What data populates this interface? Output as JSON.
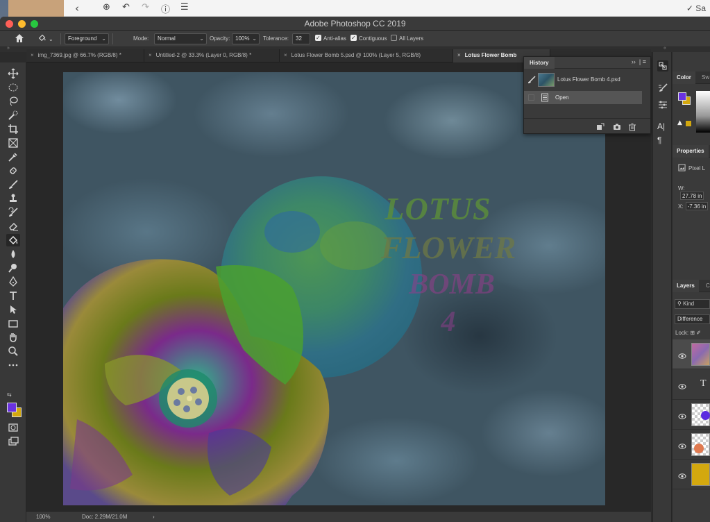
{
  "back_window": {
    "right_label": "✓ Sa"
  },
  "app": {
    "title": "Adobe Photoshop CC 2019"
  },
  "options_bar": {
    "fill_source": "Foreground",
    "mode_label": "Mode:",
    "mode_value": "Normal",
    "opacity_label": "Opacity:",
    "opacity_value": "100%",
    "tolerance_label": "Tolerance:",
    "tolerance_value": "32",
    "anti_alias": {
      "label": "Anti-alias",
      "checked": true
    },
    "contiguous": {
      "label": "Contiguous",
      "checked": true
    },
    "all_layers": {
      "label": "All Layers",
      "checked": false
    }
  },
  "tabs": [
    {
      "label": "img_7369.jpg @ 66.7% (RGB/8) *",
      "active": false
    },
    {
      "label": "Untitled-2 @ 33.3% (Layer 0, RGB/8) *",
      "active": false
    },
    {
      "label": "Lotus Flower Bomb 5.psd @ 100% (Layer 5, RGB/8)",
      "active": false
    },
    {
      "label": "Lotus Flower Bomb",
      "active": true
    }
  ],
  "canvas_text": {
    "line1": "LOTUS",
    "line2": "FLOWER",
    "line3": "BOMB",
    "line4": "4"
  },
  "status_bar": {
    "zoom": "100%",
    "doc_size": "Doc: 2.29M/21.0M",
    "arrow": "›"
  },
  "history": {
    "title": "History",
    "snapshot_label": "Lotus Flower Bomb 4.psd",
    "steps": [
      {
        "label": "Open"
      }
    ]
  },
  "right_panels": {
    "color_tab": "Color",
    "swatches_tab": "Sw",
    "properties_tab": "Properties",
    "pixel_layer_label": "Pixel L",
    "w_label": "W:",
    "w_value": "27.78 in",
    "x_label": "X:",
    "x_value": "-7.36 in",
    "layers_tab": "Layers",
    "channels_tab": "C",
    "kind_label": "Kind",
    "blend_mode": "Difference",
    "lock_label": "Lock:"
  },
  "colors": {
    "foreground": "#6a32e0",
    "background": "#d3a80f"
  }
}
